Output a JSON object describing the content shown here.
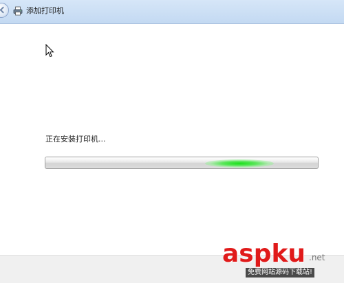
{
  "window": {
    "title": "添加打印机"
  },
  "icons": {
    "title_icon": "printer-icon",
    "cursor": "mouse-cursor-icon",
    "back": "back-arrow-icon"
  },
  "status": {
    "text": "正在安装打印机..."
  },
  "progress": {
    "mode": "indeterminate",
    "accent_color": "#22dd22"
  },
  "watermark": {
    "main": "aspku",
    "suffix": ".net",
    "sub": "免费网站源码下载站!"
  }
}
